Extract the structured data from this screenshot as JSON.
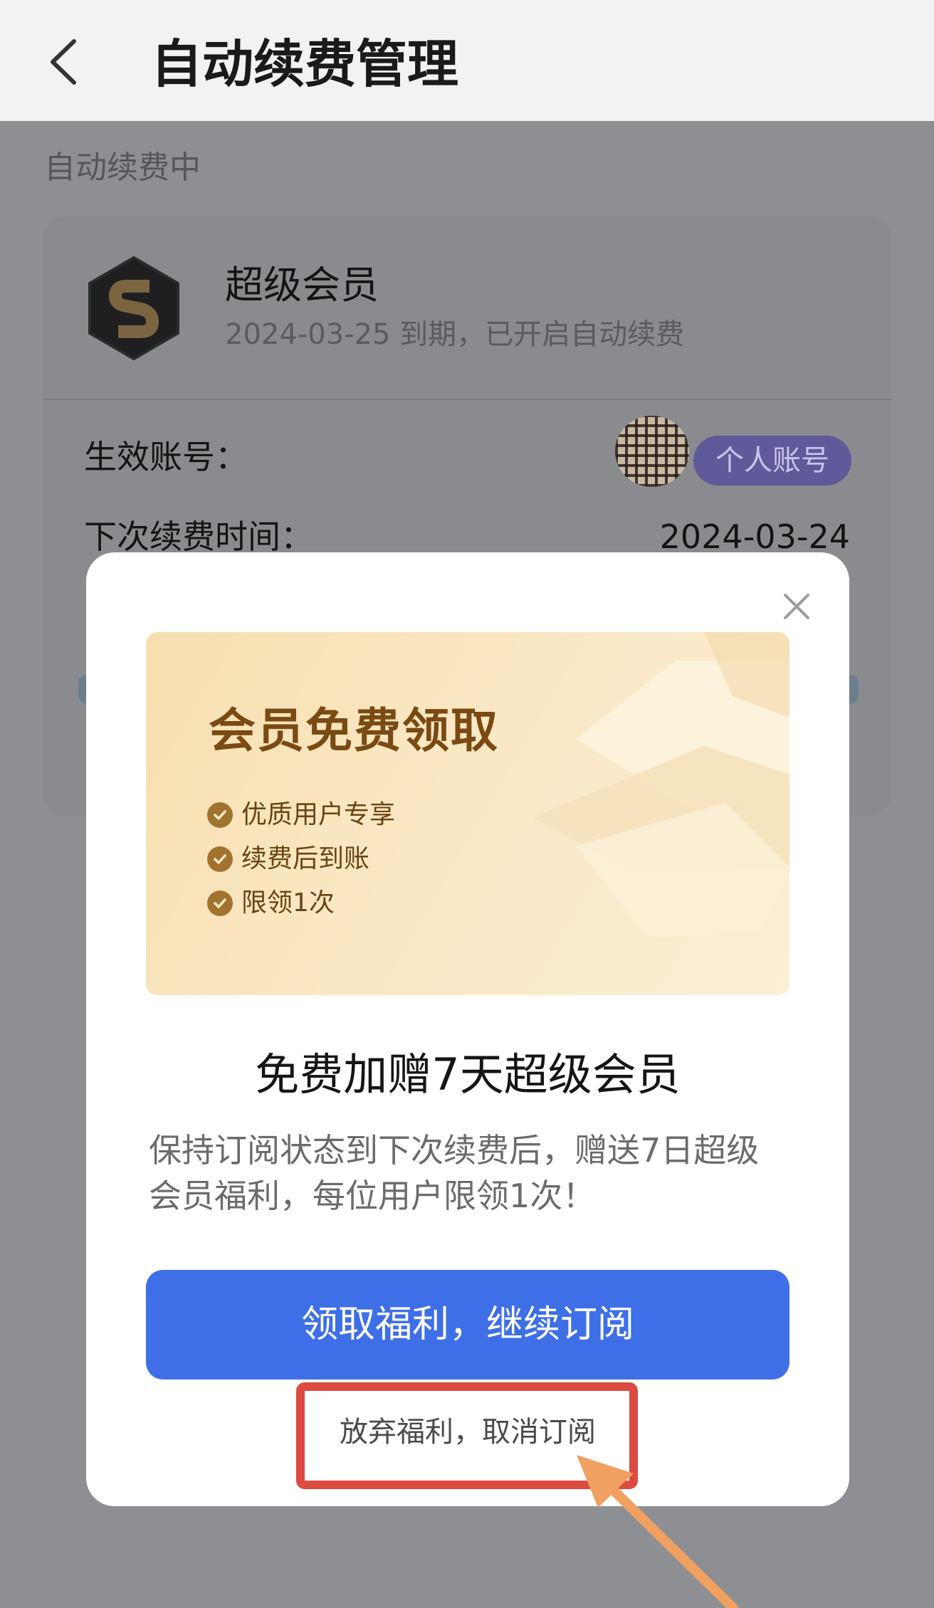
{
  "header": {
    "title": "自动续费管理",
    "back_icon": "chevron-left-icon"
  },
  "section": {
    "label": "自动续费中"
  },
  "subscription": {
    "logo_icon": "super-member-s-logo",
    "name": "超级会员",
    "status": "2024-03-25 到期，已开启自动续费",
    "account_label": "生效账号：",
    "account_badge": "个人账号",
    "renew_label": "下次续费时间：",
    "renew_date": "2024-03-24"
  },
  "modal": {
    "banner": {
      "title": "会员免费领取",
      "perks": [
        "优质用户专享",
        "续费后到账",
        "限领1次"
      ]
    },
    "offer_title": "免费加赠7天超级会员",
    "offer_desc": "保持订阅状态到下次续费后，赠送7日超级会员福利，每位用户限领1次！",
    "primary_button": "领取福利，继续订阅",
    "cancel_link": "放弃福利，取消订阅",
    "close_icon": "close-icon"
  },
  "colors": {
    "primary": "#3f6fe7",
    "overlay": "#8e8f93",
    "banner_gold": "#7a4a12",
    "annotation_red": "#dd4a40",
    "annotation_arrow": "#f0a060"
  }
}
